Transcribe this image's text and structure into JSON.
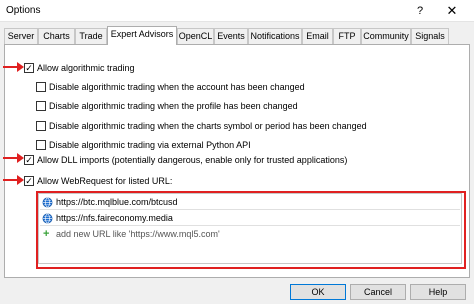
{
  "window": {
    "title": "Options",
    "help_label": "?",
    "close_label": "✕"
  },
  "tabs": [
    {
      "label": "Server"
    },
    {
      "label": "Charts"
    },
    {
      "label": "Trade"
    },
    {
      "label": "Expert Advisors",
      "active": true
    },
    {
      "label": "OpenCL"
    },
    {
      "label": "Events"
    },
    {
      "label": "Notifications"
    },
    {
      "label": "Email"
    },
    {
      "label": "FTP"
    },
    {
      "label": "Community"
    },
    {
      "label": "Signals"
    }
  ],
  "options": {
    "allow_algo": {
      "label": "Allow algorithmic trading",
      "checked": true
    },
    "disable_account": {
      "label": "Disable algorithmic trading when the account has been changed",
      "checked": false
    },
    "disable_profile": {
      "label": "Disable algorithmic trading when the profile has been changed",
      "checked": false
    },
    "disable_symbol": {
      "label": "Disable algorithmic trading when the charts symbol or period has been changed",
      "checked": false
    },
    "disable_python": {
      "label": "Disable algorithmic trading via external Python API",
      "checked": false
    },
    "allow_dll": {
      "label": "Allow DLL imports (potentially dangerous, enable only for trusted applications)",
      "checked": true
    },
    "allow_webrequest": {
      "label": "Allow WebRequest for listed URL:",
      "checked": true
    }
  },
  "check_mark": "✓",
  "urls": [
    {
      "url": "https://btc.mqlblue.com/btcusd"
    },
    {
      "url": "https://nfs.faireconomy.media"
    }
  ],
  "add_url": {
    "plus": "+",
    "text": "add new URL like 'https://www.mql5.com'"
  },
  "buttons": {
    "ok": "OK",
    "cancel": "Cancel",
    "help": "Help"
  },
  "colors": {
    "annotation_red": "#e02020",
    "globe_blue": "#1f6fd1",
    "add_green": "#3aa33a"
  }
}
